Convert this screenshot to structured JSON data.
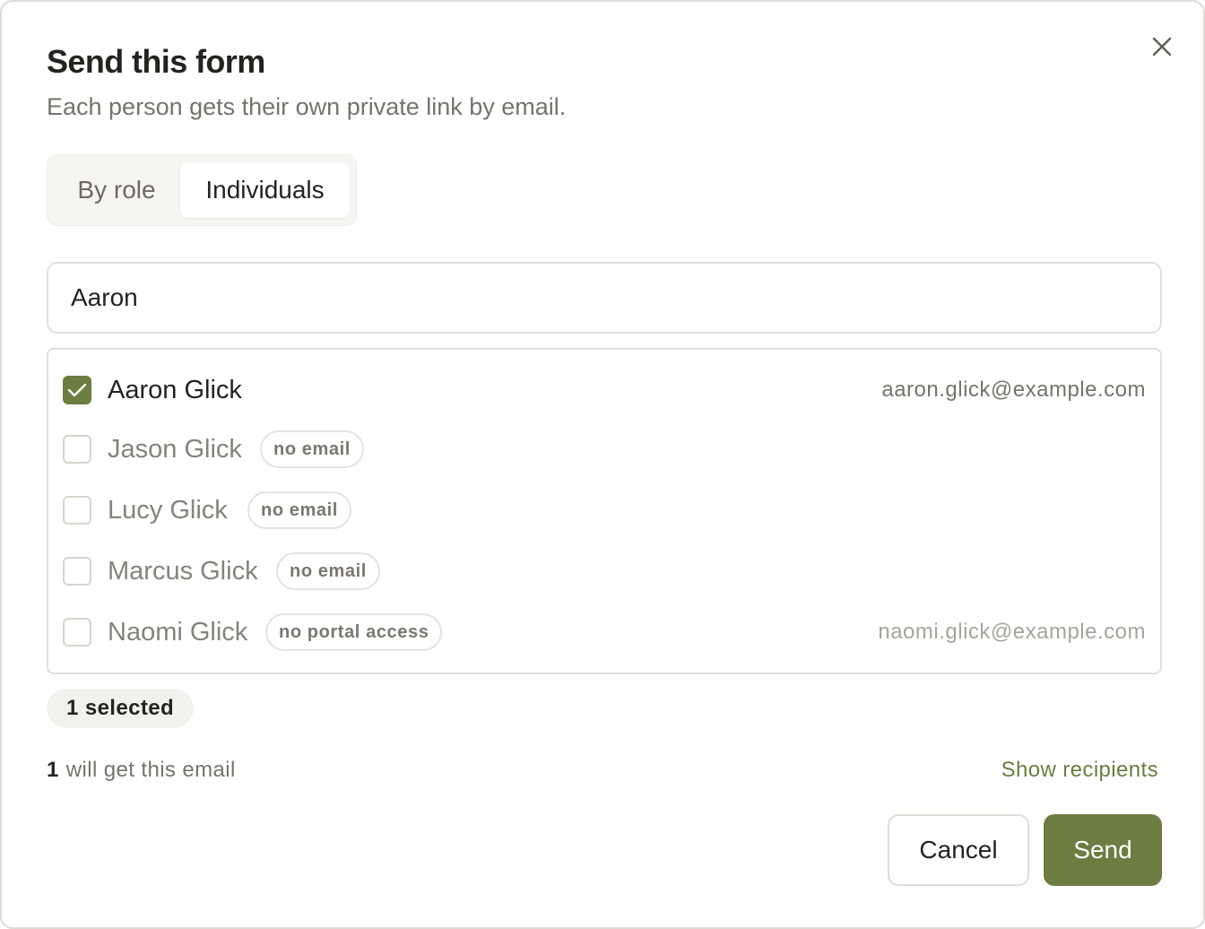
{
  "dialog": {
    "title": "Send this form",
    "subtitle": "Each person gets their own private link by email.",
    "close_icon": "close-icon"
  },
  "mode_tabs": [
    {
      "label": "By role",
      "active": false
    },
    {
      "label": "Individuals",
      "active": true
    }
  ],
  "search": {
    "value": "Aaron",
    "placeholder": ""
  },
  "people": [
    {
      "name": "Aaron Glick",
      "checked": true,
      "badge": "",
      "email": "aaron.glick@example.com"
    },
    {
      "name": "Jason Glick",
      "checked": false,
      "badge": "no email",
      "email": ""
    },
    {
      "name": "Lucy Glick",
      "checked": false,
      "badge": "no email",
      "email": ""
    },
    {
      "name": "Marcus Glick",
      "checked": false,
      "badge": "no email",
      "email": ""
    },
    {
      "name": "Naomi Glick",
      "checked": false,
      "badge": "no portal access",
      "email": "naomi.glick@example.com"
    }
  ],
  "selection": {
    "badge": "1 selected"
  },
  "summary": {
    "count": "1",
    "text": "will get this email",
    "link": "Show recipients"
  },
  "actions": {
    "cancel": "Cancel",
    "send": "Send"
  },
  "colors": {
    "accent": "#6b7d40",
    "text": "#24231f",
    "muted": "#76736b",
    "border": "#e3e0da"
  }
}
